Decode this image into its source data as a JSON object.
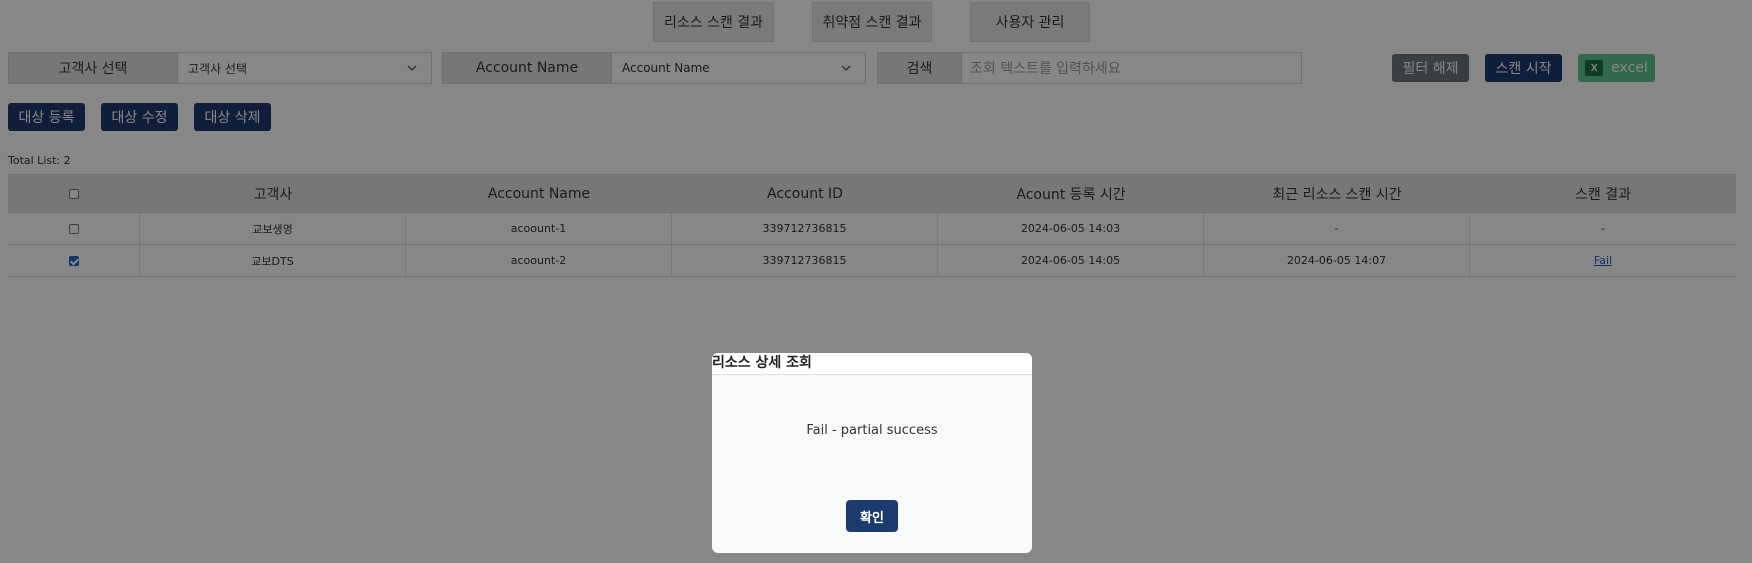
{
  "nav": {
    "tabs": [
      {
        "label": "리소스 스캔 결과"
      },
      {
        "label": "취약점 스캔 결과"
      },
      {
        "label": "사용자 관리"
      }
    ]
  },
  "filters": {
    "customer_label": "고객사 선택",
    "customer_value": "고객사 선택",
    "account_label": "Account Name",
    "account_value": "Account Name",
    "search_label": "검색",
    "search_placeholder": "조회 텍스트를 입력하세요",
    "clear_label": "필터 해제",
    "scan_label": "스캔 시작",
    "excel_label": "excel"
  },
  "actions": {
    "register_label": "대상 등록",
    "edit_label": "대상 수정",
    "delete_label": "대상 삭제"
  },
  "total_text": "Total List: 2",
  "table": {
    "headers": [
      "고객사",
      "Account Name",
      "Account ID",
      "Acount 등록 시간",
      "최근 리소스 스캔 시간",
      "스캔 결과"
    ],
    "rows": [
      {
        "checked": false,
        "customer": "교보생명",
        "account_name": "acoount-1",
        "account_id": "339712736815",
        "registered": "2024-06-05 14:03",
        "last_scan": "-",
        "result": "-"
      },
      {
        "checked": true,
        "customer": "교보DTS",
        "account_name": "acoount-2",
        "account_id": "339712736815",
        "registered": "2024-06-05 14:05",
        "last_scan": "2024-06-05 14:07",
        "result": "Fail"
      }
    ]
  },
  "modal": {
    "title": "리소스 상세 조회",
    "message": "Fail - partial success",
    "ok_label": "확인"
  },
  "colors": {
    "primary": "#1d3a6e",
    "excel": "#5fc48f",
    "link": "#1d67c6"
  }
}
